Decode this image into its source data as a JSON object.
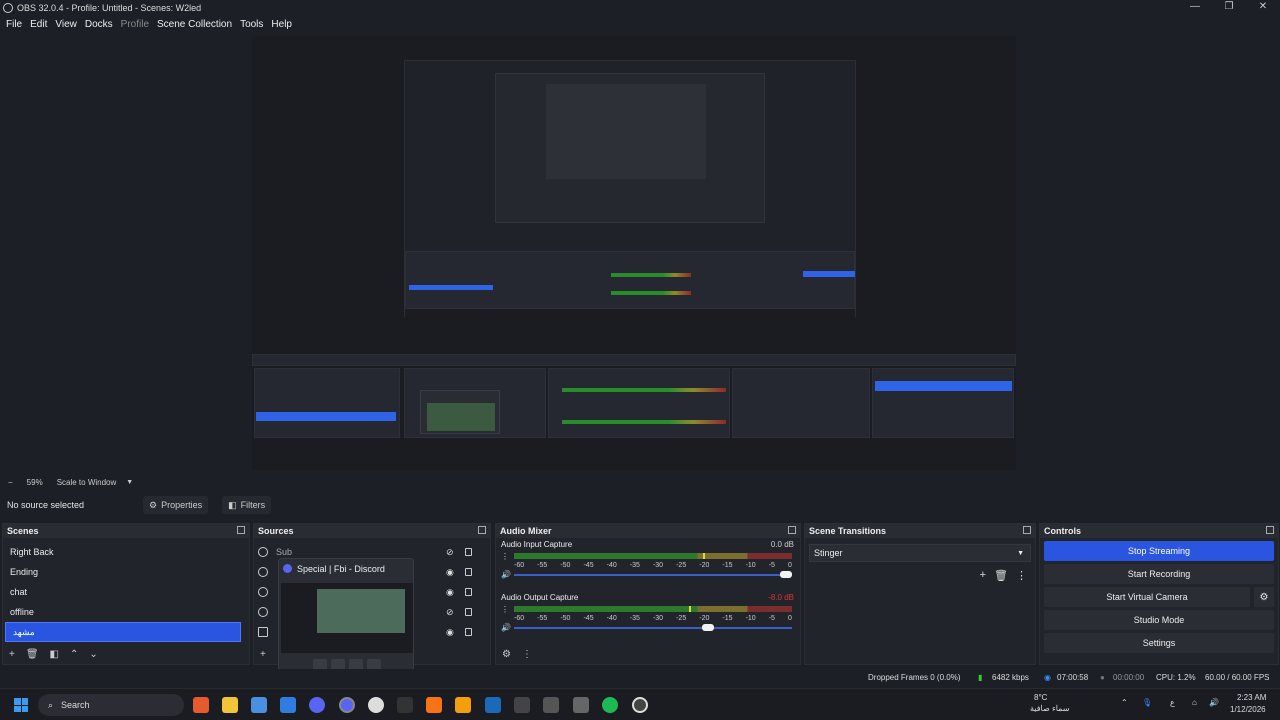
{
  "window": {
    "title": "OBS 32.0.4 - Profile: Untitled - Scenes: W2led",
    "minimize": "—",
    "maximize": "❐",
    "close": "✕"
  },
  "menu": {
    "file": "File",
    "edit": "Edit",
    "view": "View",
    "docks": "Docks",
    "profile": "Profile",
    "scene_collection": "Scene Collection",
    "tools": "Tools",
    "help": "Help"
  },
  "zoom": {
    "minus": "−",
    "value": "59%",
    "mode": "Scale to Window",
    "caret": "▼"
  },
  "context": {
    "no_source": "No source selected",
    "properties": "Properties",
    "filters": "Filters"
  },
  "scenes": {
    "title": "Scenes",
    "items": [
      "Right Back",
      "Ending",
      "chat",
      "offline",
      "مشهد"
    ]
  },
  "sources": {
    "title": "Sources",
    "items": [
      "Sub",
      "",
      "",
      "",
      ""
    ]
  },
  "hover_card": {
    "title": "Special | Fbi - Discord"
  },
  "audio_mixer": {
    "title": "Audio Mixer",
    "tracks": [
      {
        "name": "Audio Input Capture",
        "db": "0.0 dB",
        "level": 0.68,
        "volume": 1.0
      },
      {
        "name": "Audio Output Capture",
        "db": "-8.0 dB",
        "level": 0.63,
        "volume": 0.72
      }
    ],
    "ticks": [
      "-60",
      "-55",
      "-50",
      "-45",
      "-40",
      "-35",
      "-30",
      "-25",
      "-20",
      "-15",
      "-10",
      "-5",
      "0"
    ]
  },
  "transitions": {
    "title": "Scene Transitions",
    "selected": "Stinger",
    "add": "+",
    "remove": "🗑",
    "more": "⋮"
  },
  "controls": {
    "title": "Controls",
    "stop_streaming": "Stop Streaming",
    "start_recording": "Start Recording",
    "start_virtual_camera": "Start Virtual Camera",
    "studio_mode": "Studio Mode",
    "settings": "Settings",
    "gear": "⚙"
  },
  "status": {
    "dropped": "Dropped Frames 0 (0.0%)",
    "bitrate": "6482 kbps",
    "stream_time": "07:00:58",
    "rec_time": "00:00:00",
    "cpu": "CPU: 1.2%",
    "fps": "60.00 / 60.00 FPS"
  },
  "taskbar": {
    "search": "Search",
    "weather_temp": "8°C",
    "weather_desc": "سماء صافية",
    "lang": "ع",
    "time": "2:23 AM",
    "date": "1/12/2026",
    "badge": "3"
  },
  "colors": {
    "accent": "#2a55e0",
    "bg": "#1d1f26",
    "panel": "#22242b"
  }
}
